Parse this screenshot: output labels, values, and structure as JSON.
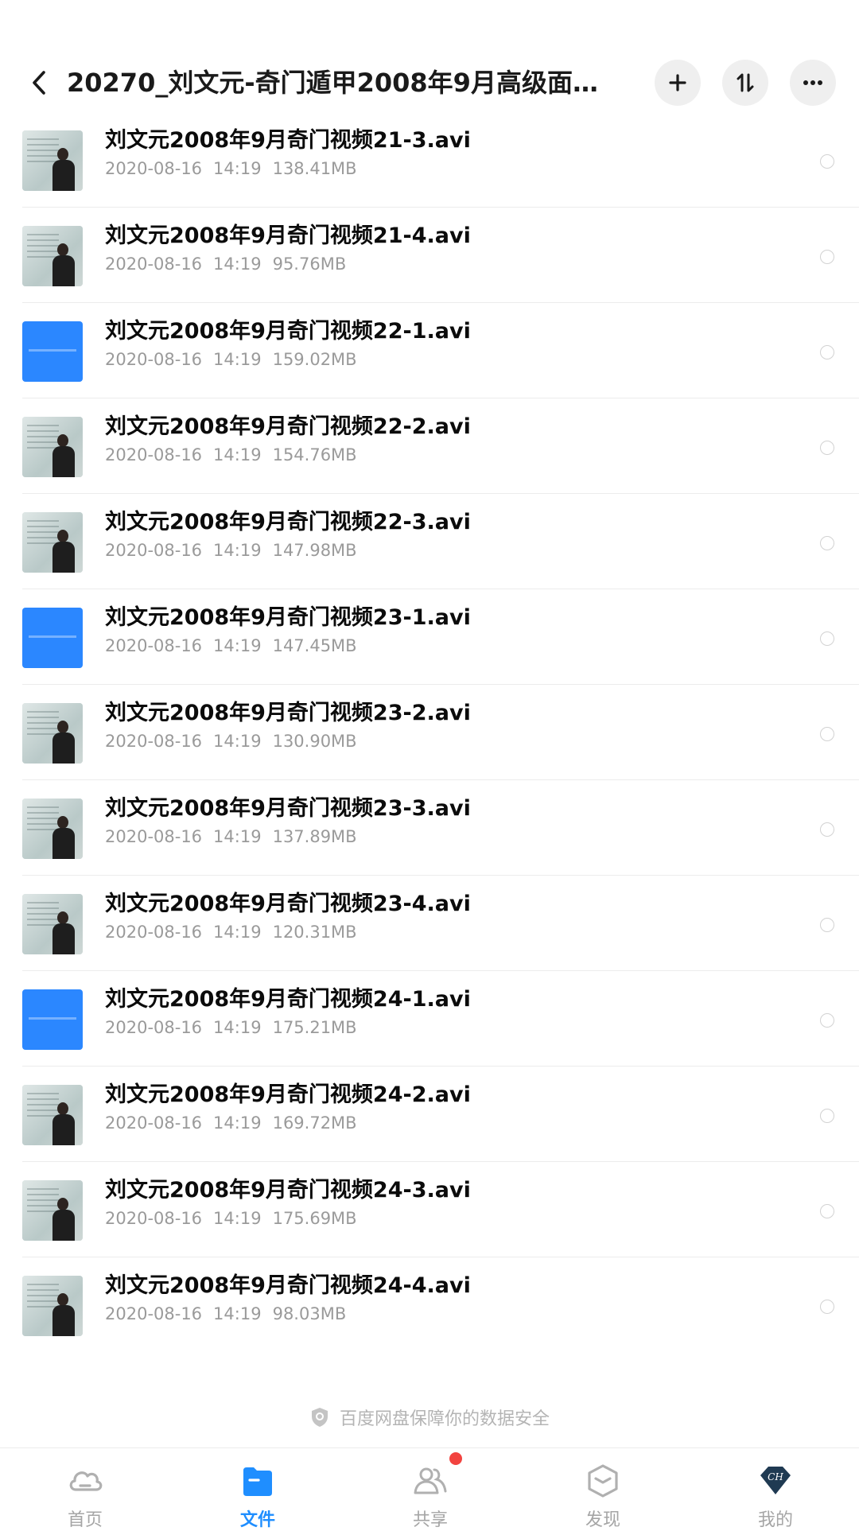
{
  "header": {
    "title": "20270_刘文元-奇门遁甲2008年9月高级面授班...",
    "back_icon": "chevron-left-icon",
    "actions": [
      "add-icon",
      "sort-icon",
      "more-icon"
    ]
  },
  "files": [
    {
      "name": "刘文元2008年9月奇门视频21-3.avi",
      "date": "2020-08-16",
      "time": "14:19",
      "size": "138.41MB",
      "thumb": "video"
    },
    {
      "name": "刘文元2008年9月奇门视频21-4.avi",
      "date": "2020-08-16",
      "time": "14:19",
      "size": "95.76MB",
      "thumb": "video"
    },
    {
      "name": "刘文元2008年9月奇门视频22-1.avi",
      "date": "2020-08-16",
      "time": "14:19",
      "size": "159.02MB",
      "thumb": "blue"
    },
    {
      "name": "刘文元2008年9月奇门视频22-2.avi",
      "date": "2020-08-16",
      "time": "14:19",
      "size": "154.76MB",
      "thumb": "video"
    },
    {
      "name": "刘文元2008年9月奇门视频22-3.avi",
      "date": "2020-08-16",
      "time": "14:19",
      "size": "147.98MB",
      "thumb": "video"
    },
    {
      "name": "刘文元2008年9月奇门视频23-1.avi",
      "date": "2020-08-16",
      "time": "14:19",
      "size": "147.45MB",
      "thumb": "blue"
    },
    {
      "name": "刘文元2008年9月奇门视频23-2.avi",
      "date": "2020-08-16",
      "time": "14:19",
      "size": "130.90MB",
      "thumb": "video"
    },
    {
      "name": "刘文元2008年9月奇门视频23-3.avi",
      "date": "2020-08-16",
      "time": "14:19",
      "size": "137.89MB",
      "thumb": "video"
    },
    {
      "name": "刘文元2008年9月奇门视频23-4.avi",
      "date": "2020-08-16",
      "time": "14:19",
      "size": "120.31MB",
      "thumb": "video"
    },
    {
      "name": "刘文元2008年9月奇门视频24-1.avi",
      "date": "2020-08-16",
      "time": "14:19",
      "size": "175.21MB",
      "thumb": "blue"
    },
    {
      "name": "刘文元2008年9月奇门视频24-2.avi",
      "date": "2020-08-16",
      "time": "14:19",
      "size": "169.72MB",
      "thumb": "video"
    },
    {
      "name": "刘文元2008年9月奇门视频24-3.avi",
      "date": "2020-08-16",
      "time": "14:19",
      "size": "175.69MB",
      "thumb": "video"
    },
    {
      "name": "刘文元2008年9月奇门视频24-4.avi",
      "date": "2020-08-16",
      "time": "14:19",
      "size": "98.03MB",
      "thumb": "video"
    }
  ],
  "safety_text": "百度网盘保障你的数据安全",
  "nav": [
    {
      "label": "首页",
      "icon": "cloud-icon",
      "active": false
    },
    {
      "label": "文件",
      "icon": "folder-icon",
      "active": true
    },
    {
      "label": "共享",
      "icon": "people-icon",
      "active": false,
      "badge": true
    },
    {
      "label": "发现",
      "icon": "hexagon-icon",
      "active": false
    },
    {
      "label": "我的",
      "icon": "avatar-icon",
      "active": false,
      "avatar_text": "CH"
    }
  ],
  "colors": {
    "accent": "#1f8eff",
    "badge": "#f2433f",
    "thumb_blue": "#2b87ff"
  }
}
